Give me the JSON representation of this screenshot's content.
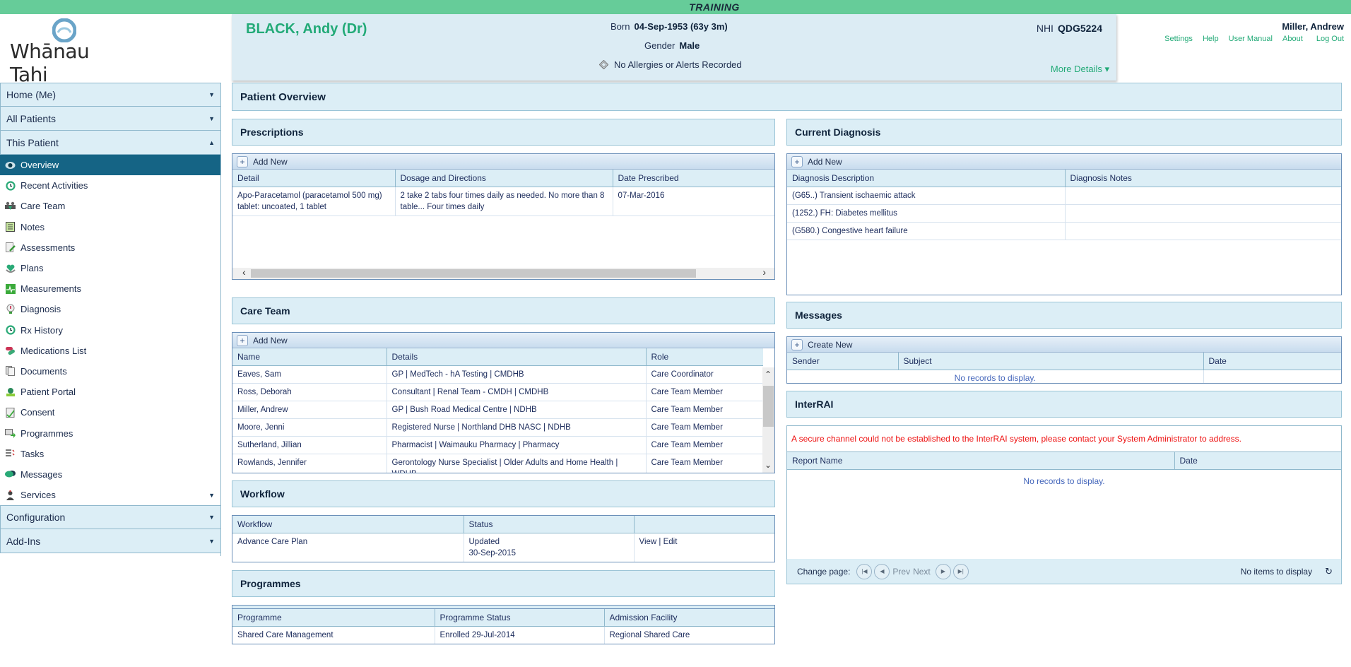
{
  "environment_banner": "TRAINING",
  "logo": {
    "text": "Whānau Tahi"
  },
  "patient": {
    "name": "BLACK, Andy (Dr)",
    "born_label": "Born",
    "born_value": "04-Sep-1953 (63y 3m)",
    "gender_label": "Gender",
    "gender_value": "Male",
    "allergies": "No Allergies or Alerts Recorded",
    "nhi_label": "NHI",
    "nhi_value": "QDG5224",
    "more_details": "More Details ▾"
  },
  "user": {
    "name": "Miller, Andrew",
    "links": [
      "Settings",
      "Help",
      "User Manual",
      "About",
      "Log Out"
    ]
  },
  "sidebar": {
    "sections": [
      {
        "label": "Home (Me)",
        "caret": "▼"
      },
      {
        "label": "All Patients",
        "caret": "▼"
      },
      {
        "label": "This Patient",
        "caret": "▲"
      }
    ],
    "items": [
      {
        "label": "Overview",
        "icon": "eye-icon"
      },
      {
        "label": "Recent Activities",
        "icon": "clock-icon"
      },
      {
        "label": "Care Team",
        "icon": "care-team-icon"
      },
      {
        "label": "Notes",
        "icon": "notes-icon"
      },
      {
        "label": "Assessments",
        "icon": "assessments-icon"
      },
      {
        "label": "Plans",
        "icon": "plans-icon"
      },
      {
        "label": "Measurements",
        "icon": "measurements-icon"
      },
      {
        "label": "Diagnosis",
        "icon": "diagnosis-icon"
      },
      {
        "label": "Rx History",
        "icon": "rx-history-icon"
      },
      {
        "label": "Medications List",
        "icon": "medications-icon"
      },
      {
        "label": "Documents",
        "icon": "documents-icon"
      },
      {
        "label": "Patient Portal",
        "icon": "patient-portal-icon"
      },
      {
        "label": "Consent",
        "icon": "consent-icon"
      },
      {
        "label": "Programmes",
        "icon": "programmes-icon"
      },
      {
        "label": "Tasks",
        "icon": "tasks-icon"
      },
      {
        "label": "Messages",
        "icon": "messages-icon"
      },
      {
        "label": "Services",
        "icon": "services-icon",
        "caret": "▼"
      }
    ],
    "bottom_sections": [
      {
        "label": "Configuration",
        "caret": "▼"
      },
      {
        "label": "Add-Ins",
        "caret": "▼"
      }
    ]
  },
  "main": {
    "title": "Patient Overview",
    "prescriptions": {
      "title": "Prescriptions",
      "add_label": "Add New",
      "columns": [
        "Detail",
        "Dosage and Directions",
        "Date Prescribed"
      ],
      "rows": [
        [
          "Apo-Paracetamol (paracetamol 500 mg) tablet: uncoated, 1 tablet",
          "2 take 2 tabs four times daily as needed. No more than 8 table... Four times daily",
          "07-Mar-2016"
        ]
      ]
    },
    "care_team": {
      "title": "Care Team",
      "add_label": "Add New",
      "columns": [
        "Name",
        "Details",
        "Role"
      ],
      "rows": [
        [
          "Eaves, Sam",
          "GP | MedTech - hA Testing | CMDHB",
          "Care Coordinator"
        ],
        [
          "Ross, Deborah",
          "Consultant | Renal Team - CMDH | CMDHB",
          "Care Team Member"
        ],
        [
          "Miller, Andrew",
          "GP | Bush Road Medical Centre | NDHB",
          "Care Team Member"
        ],
        [
          "Moore, Jenni",
          "Registered Nurse | Northland DHB NASC | NDHB",
          "Care Team Member"
        ],
        [
          "Sutherland, Jillian",
          "Pharmacist | Waimauku Pharmacy | Pharmacy",
          "Care Team Member"
        ],
        [
          "Rowlands, Jennifer",
          "Gerontology Nurse Specialist | Older Adults and Home Health | WDHB",
          "Care Team Member"
        ]
      ]
    },
    "workflow": {
      "title": "Workflow",
      "columns": [
        "Workflow",
        "Status",
        ""
      ],
      "rows": [
        {
          "name": "Advance Care Plan",
          "status_line1": "Updated",
          "status_line2": "30-Sep-2015",
          "view": "View",
          "sep": " | ",
          "edit": "Edit"
        }
      ]
    },
    "programmes": {
      "title": "Programmes",
      "columns": [
        "Programme",
        "Programme Status",
        "Admission Facility"
      ],
      "rows": [
        [
          "Shared Care Management",
          "Enrolled 29-Jul-2014",
          "Regional Shared Care"
        ]
      ]
    },
    "diagnosis": {
      "title": "Current Diagnosis",
      "add_label": "Add New",
      "columns": [
        "Diagnosis Description",
        "Diagnosis Notes"
      ],
      "rows": [
        [
          "(G65..) Transient ischaemic attack",
          ""
        ],
        [
          "(1252.) FH: Diabetes mellitus",
          ""
        ],
        [
          "(G580.) Congestive heart failure",
          ""
        ]
      ]
    },
    "messages": {
      "title": "Messages",
      "add_label": "Create New",
      "columns": [
        "Sender",
        "Subject",
        "Date"
      ],
      "empty": "No records to display."
    },
    "interrai": {
      "title": "InterRAI",
      "error": "A secure channel could not be established to the InterRAI system, please contact your System Administrator to address.",
      "columns": [
        "Report Name",
        "Date"
      ],
      "empty": "No records to display.",
      "pager": {
        "label": "Change page:",
        "prev": "Prev",
        "next": "Next",
        "status": "No items to display"
      }
    }
  },
  "colors": {
    "banner_green": "#66cc99",
    "accent_green": "#22aa77",
    "active_nav": "#156485",
    "panel_bg": "#dceef6",
    "error_red": "#ee1111"
  }
}
